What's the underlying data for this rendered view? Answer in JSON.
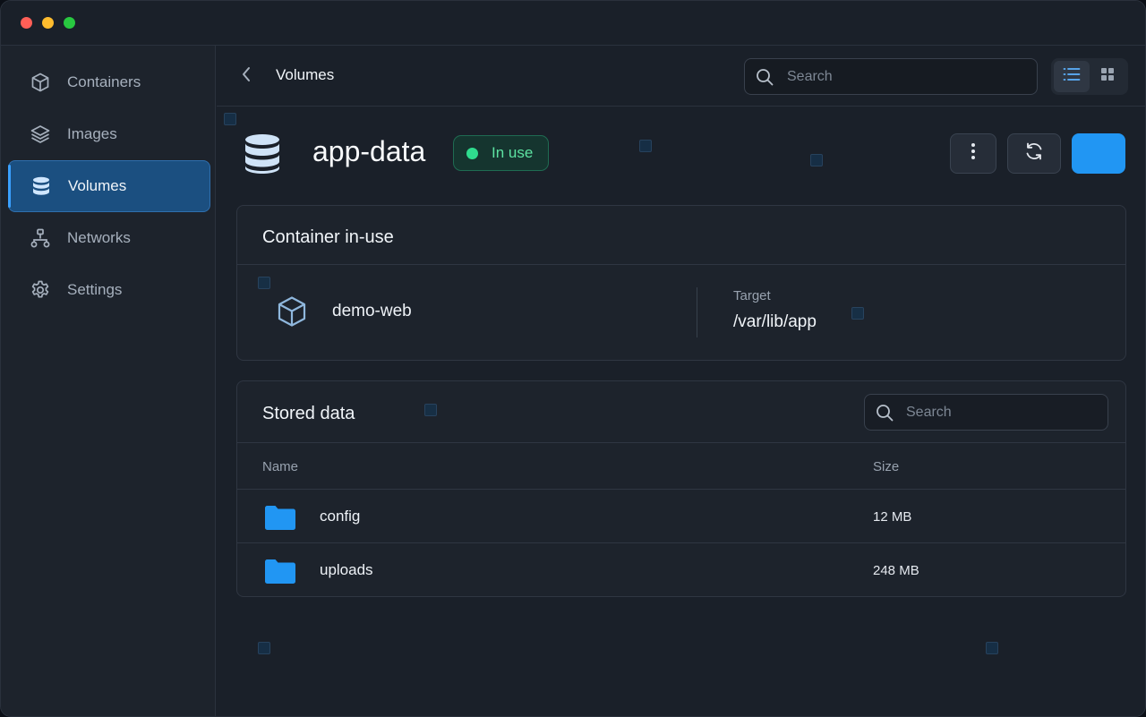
{
  "window": {
    "traffic_lights": [
      "close",
      "minimize",
      "maximize"
    ]
  },
  "sidebar": {
    "items": [
      {
        "label": "Containers",
        "icon": "cube-icon"
      },
      {
        "label": "Images",
        "icon": "layers-icon"
      },
      {
        "label": "Volumes",
        "icon": "database-icon",
        "active": true
      },
      {
        "label": "Networks",
        "icon": "network-icon"
      },
      {
        "label": "Settings",
        "icon": "gear-icon"
      }
    ]
  },
  "topbar": {
    "breadcrumb": "Volumes",
    "search_placeholder": "Search"
  },
  "volume": {
    "name": "app-data",
    "status": "In use"
  },
  "container_card": {
    "title": "Container in-use",
    "container_name": "demo-web",
    "target_label": "Target",
    "target_value": "/var/lib/app"
  },
  "stored_data": {
    "title": "Stored data",
    "search_placeholder": "Search",
    "columns": {
      "name": "Name",
      "size": "Size"
    },
    "rows": [
      {
        "name": "config",
        "size": "12 MB"
      },
      {
        "name": "uploads",
        "size": "248 MB"
      }
    ]
  },
  "colors": {
    "accent": "#2196f3",
    "status_green": "#2fdc8e",
    "active_nav": "#1b4f80"
  }
}
